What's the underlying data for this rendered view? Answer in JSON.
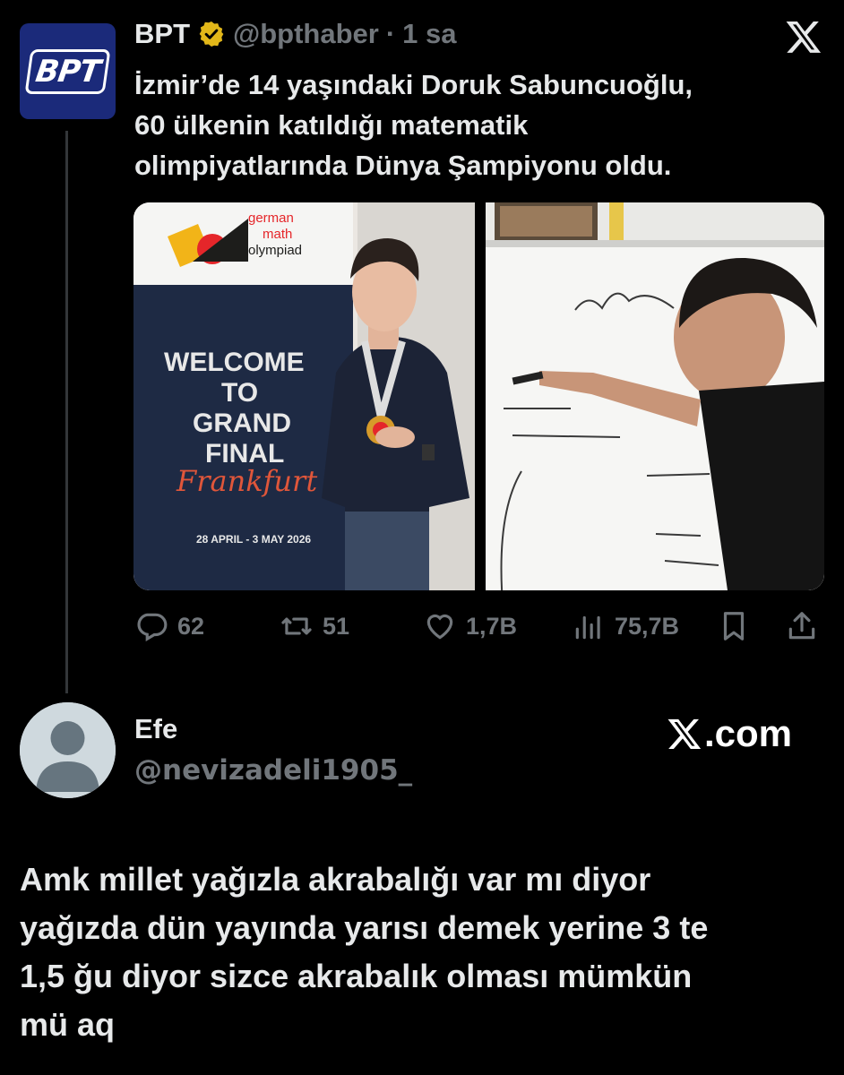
{
  "tweet": {
    "author_name": "BPT",
    "avatar_logo": "BPT",
    "handle": "@bpthaber",
    "separator": "·",
    "time": "1 sa",
    "text_lines": [
      "İzmir’de 14 yaşındaki Doruk Sabuncuoğlu,",
      "60 ülkenin katıldığı matematik",
      "olimpiyatlarında Dünya Şampiyonu oldu."
    ],
    "media": {
      "banner_lines": [
        "german",
        "math",
        "olympiad"
      ],
      "welcome_lines": [
        "WELCOME",
        "TO",
        "GRAND",
        "FINAL"
      ],
      "city": "Frankfurt",
      "dates": "28 APRIL - 3 MAY 2026"
    },
    "stats": {
      "replies": "62",
      "reposts": "51",
      "likes": "1,7B",
      "views": "75,7B"
    }
  },
  "reply": {
    "author_name": "Efe",
    "handle": "@nevizadeli1905_",
    "source_label": ".com",
    "text_lines": [
      "Amk millet yağızla akrabalığı var mı diyor",
      "yağızda dün yayında yarısı demek yerine 3 te",
      "1,5 ğu diyor sizce akrabalık olması mümkün",
      "mü aq"
    ]
  },
  "icons": {
    "verified": "verified-badge-icon",
    "x_logo": "x-logo-icon",
    "reply": "reply-icon",
    "repost": "repost-icon",
    "like": "heart-icon",
    "views": "views-icon",
    "bookmark": "bookmark-icon",
    "share": "share-icon"
  },
  "colors": {
    "background": "#000000",
    "text": "#e7e9ea",
    "muted": "#71767b",
    "verified_gold": "#e2b719",
    "bpt_blue": "#1b2a7a"
  }
}
